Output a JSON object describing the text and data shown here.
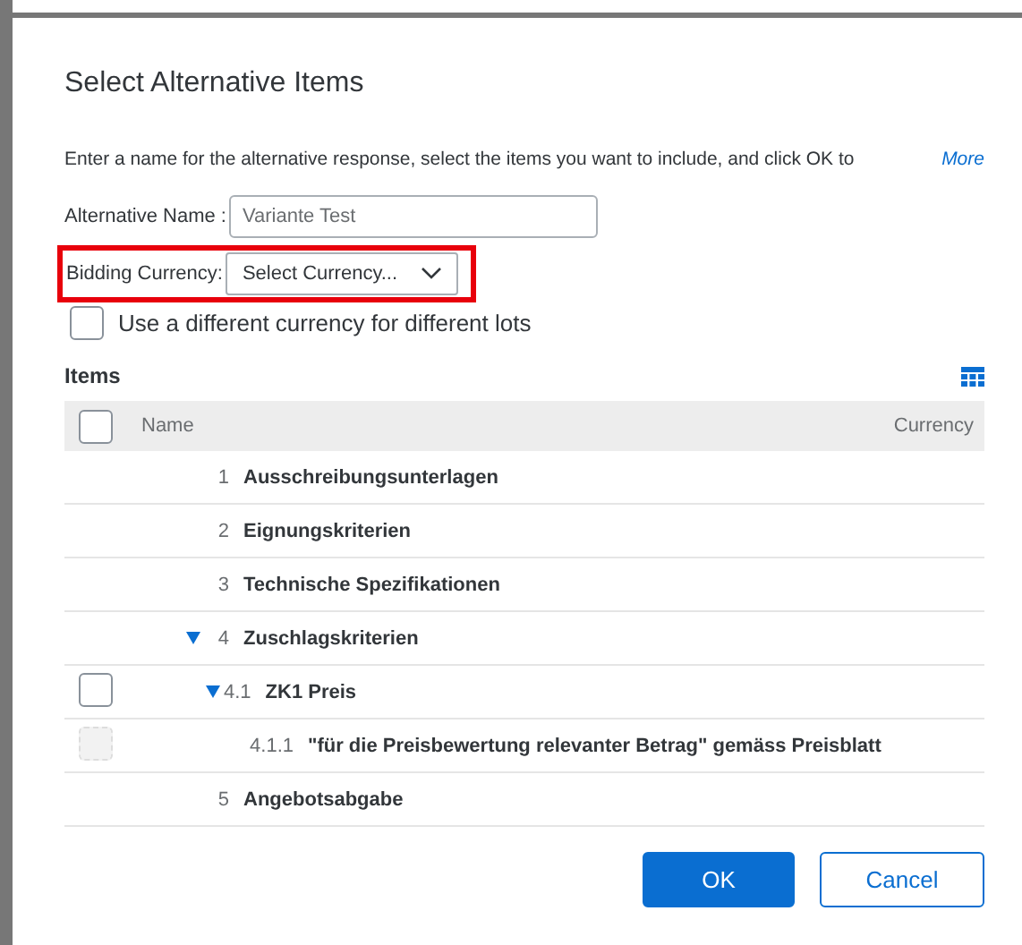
{
  "dialog": {
    "title": "Select Alternative Items",
    "description": "Enter a name for the alternative response, select the items you want to include, and click OK to",
    "more_link": "More",
    "alternative_name": {
      "label": "Alternative Name :",
      "value": "Variante Test"
    },
    "bidding_currency": {
      "label": "Bidding Currency:",
      "value": "Select Currency...",
      "highlighted": true
    },
    "different_currency": {
      "label": "Use a different currency for different lots",
      "checked": false
    },
    "items": {
      "title": "Items",
      "columns": [
        "Name",
        "Currency"
      ],
      "select_all": {
        "checked": false,
        "disabled": false
      },
      "rows": [
        {
          "number": "1",
          "name": "Ausschreibungsunterlagen"
        },
        {
          "number": "2",
          "name": "Eignungskriterien"
        },
        {
          "number": "3",
          "name": "Technische Spezifikationen"
        },
        {
          "number": "4",
          "name": "Zuschlagskriterien",
          "expanded": true,
          "children": [
            {
              "number": "4.1",
              "name": "ZK1 Preis",
              "expanded": true,
              "checkbox": {
                "checked": false,
                "disabled": false
              },
              "children": [
                {
                  "number": "4.1.1",
                  "name": "\"für die Preisbewertung relevanter Betrag\" gemäss Preisblatt",
                  "checkbox": {
                    "checked": false,
                    "disabled": true
                  }
                }
              ]
            }
          ]
        },
        {
          "number": "5",
          "name": "Angebotsabgabe"
        }
      ]
    },
    "buttons": [
      {
        "label": "OK",
        "kind": "primary"
      },
      {
        "label": "Cancel",
        "kind": "secondary"
      }
    ]
  }
}
